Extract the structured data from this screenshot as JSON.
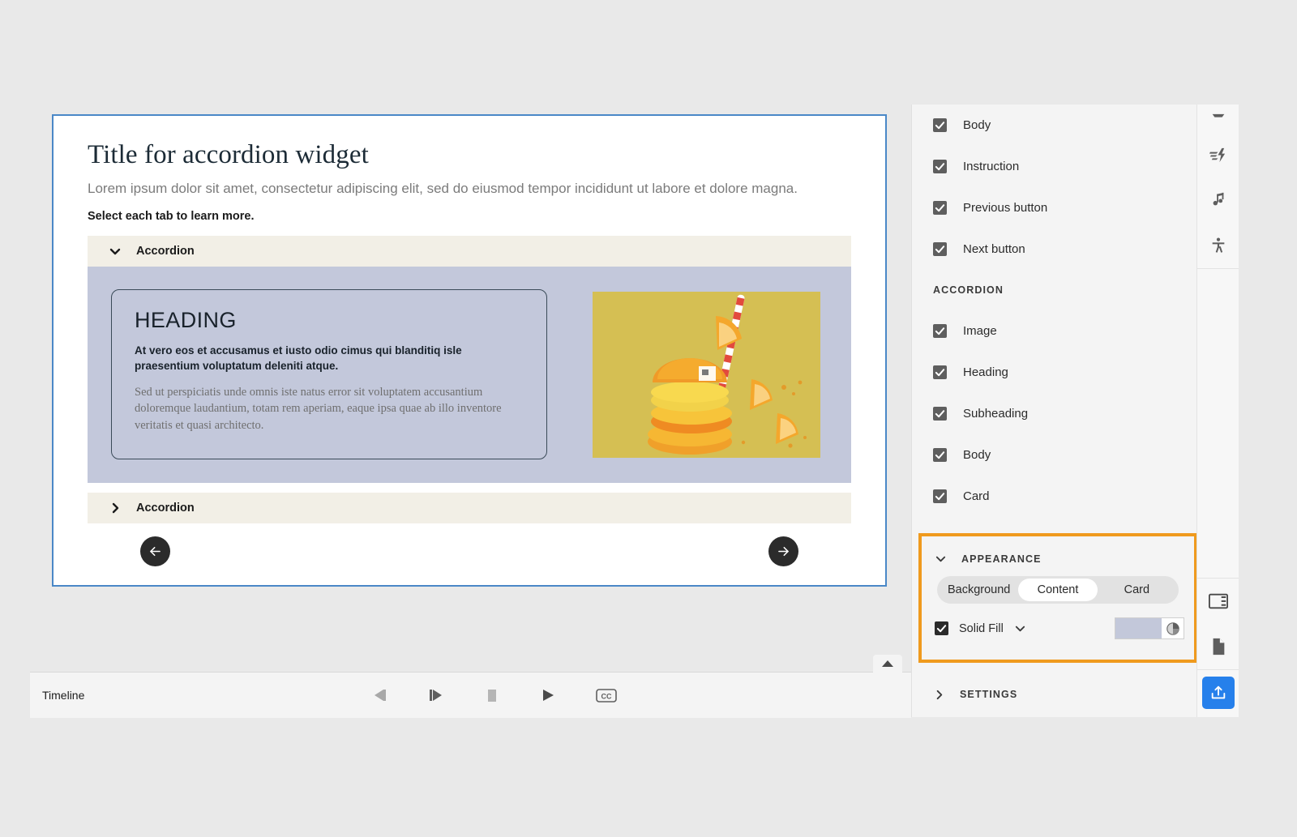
{
  "slide": {
    "title": "Title for accordion widget",
    "subtitle": "Lorem ipsum dolor sit amet, consectetur adipiscing elit, sed do eiusmod tempor incididunt ut labore et dolore magna.",
    "instruction": "Select each tab to learn more.",
    "accordion_1_label": "Accordion",
    "accordion_2_label": "Accordion",
    "card": {
      "heading": "HEADING",
      "subheading": "At vero eos et accusamus et iusto odio cimus qui blanditiq isle praesentium voluptatum deleniti atque.",
      "body": "Sed ut perspiciatis unde omnis iste natus error sit voluptatem accusantium doloremque laudantium, totam rem aperiam, eaque ipsa quae ab illo inventore veritatis et quasi architecto."
    },
    "prev_icon": "arrow-left-icon",
    "next_icon": "arrow-right-icon",
    "selection_color": "#4a88c7"
  },
  "timeline": {
    "label": "Timeline",
    "controls": [
      {
        "name": "step-back-button",
        "icon": "step-backward-icon"
      },
      {
        "name": "step-forward-button",
        "icon": "step-forward-icon"
      },
      {
        "name": "stop-button",
        "icon": "stop-icon"
      },
      {
        "name": "play-button",
        "icon": "play-icon"
      },
      {
        "name": "captions-button",
        "icon": "closed-captions-icon",
        "label": "CC"
      }
    ],
    "collapse_icon": "caret-up-icon"
  },
  "properties": {
    "top_items": [
      {
        "label": "Body",
        "checked": true
      },
      {
        "label": "Instruction",
        "checked": true
      },
      {
        "label": "Previous button",
        "checked": true
      },
      {
        "label": "Next button",
        "checked": true
      }
    ],
    "group_caption": "ACCORDION",
    "accordion_items": [
      {
        "label": "Image",
        "checked": true
      },
      {
        "label": "Heading",
        "checked": true
      },
      {
        "label": "Subheading",
        "checked": true
      },
      {
        "label": "Body",
        "checked": true
      },
      {
        "label": "Card",
        "checked": true
      }
    ],
    "appearance": {
      "caption": "APPEARANCE",
      "expanded_icon": "chevron-down-icon",
      "segments": [
        {
          "label": "Background",
          "active": false
        },
        {
          "label": "Content",
          "active": true
        },
        {
          "label": "Card",
          "active": false
        }
      ],
      "fill_label": "Solid Fill",
      "fill_checked": true,
      "fill_dropdown_icon": "chevron-down-icon",
      "swatch_color": "#c3c8da",
      "opacity_icon": "opacity-pie-icon",
      "highlight_color": "#ef9a1e"
    },
    "settings": {
      "caption": "SETTINGS",
      "collapsed_icon": "chevron-right-icon"
    }
  },
  "rail": {
    "top": [
      {
        "name": "states-icon",
        "icon": "states-icon"
      },
      {
        "name": "motion-icon",
        "icon": "motion-effects-icon"
      },
      {
        "name": "audio-icon",
        "icon": "music-note-icon"
      },
      {
        "name": "accessibility-icon",
        "icon": "accessibility-icon"
      }
    ],
    "bottom": [
      {
        "name": "properties-panel-icon",
        "icon": "layout-panel-icon"
      },
      {
        "name": "document-icon",
        "icon": "page-icon"
      },
      {
        "name": "publish-button",
        "icon": "publish-upload-icon",
        "color": "#2680eb"
      }
    ]
  }
}
